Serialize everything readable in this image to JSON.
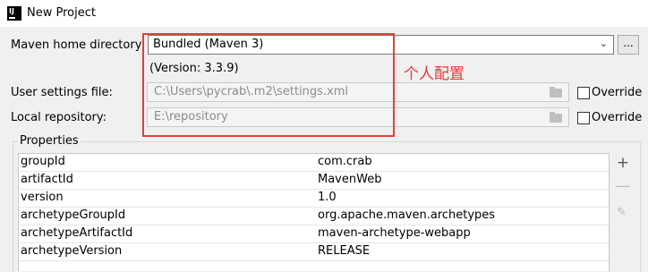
{
  "window": {
    "title": "New Project"
  },
  "form": {
    "maven_home_label": "Maven home directory:",
    "maven_home_value": "Bundled (Maven 3)",
    "maven_home_browse": "...",
    "version_text": "(Version: 3.3.9)",
    "annotation": "个人配置",
    "user_settings_label": "User settings file:",
    "user_settings_value": "C:\\Users\\pycrab\\.m2\\settings.xml",
    "local_repo_label": "Local repository:",
    "local_repo_value": "E:\\repository",
    "override_label": "Override"
  },
  "properties": {
    "title": "Properties",
    "rows": [
      {
        "key": "groupId",
        "value": "com.crab"
      },
      {
        "key": "artifactId",
        "value": "MavenWeb"
      },
      {
        "key": "version",
        "value": "1.0"
      },
      {
        "key": "archetypeGroupId",
        "value": "org.apache.maven.archetypes"
      },
      {
        "key": "archetypeArtifactId",
        "value": "maven-archetype-webapp"
      },
      {
        "key": "archetypeVersion",
        "value": "RELEASE"
      }
    ],
    "add_symbol": "+",
    "remove_symbol": "—",
    "edit_symbol": "✎"
  },
  "colors": {
    "annotation": "#e8383a",
    "highlight_box": "#e0403a"
  }
}
